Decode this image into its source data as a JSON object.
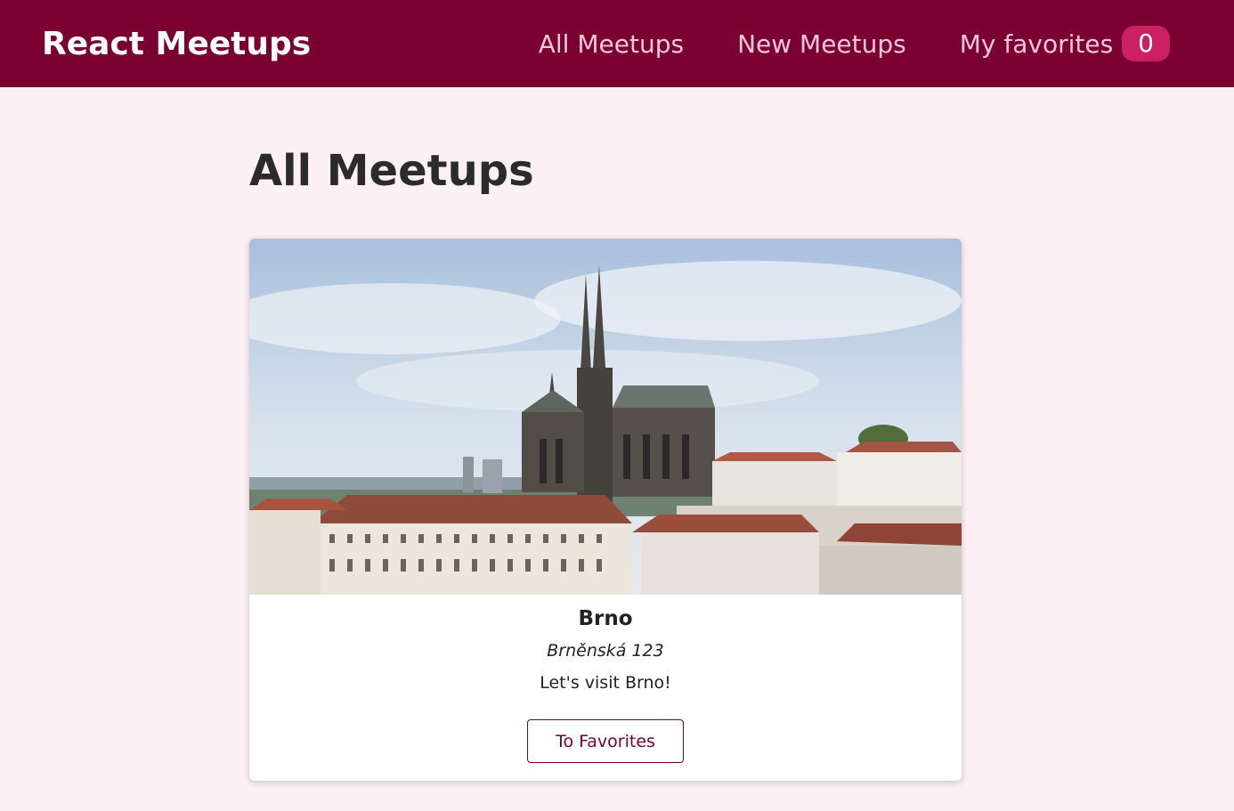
{
  "header": {
    "logo": "React Meetups",
    "nav": {
      "all_meetups": "All Meetups",
      "new_meetups": "New Meetups",
      "my_favorites": "My favorites",
      "favorites_count": "0"
    }
  },
  "main": {
    "title": "All Meetups",
    "meetups": [
      {
        "title": "Brno",
        "address": "Brněnská 123",
        "description": "Let's visit Brno!",
        "button_label": "To Favorites"
      }
    ]
  },
  "colors": {
    "header_bg": "#7a0030",
    "nav_text": "#f9c6da",
    "badge_bg": "#cc2062",
    "page_bg": "#fdf0f4",
    "accent": "#7a0030"
  }
}
